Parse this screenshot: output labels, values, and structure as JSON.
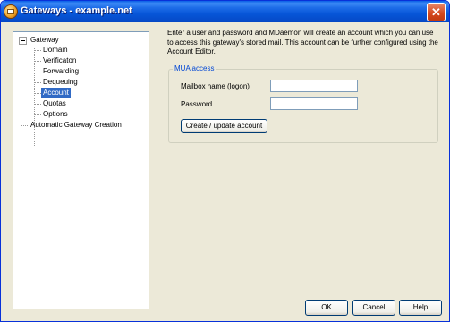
{
  "window": {
    "title": "Gateways - example.net",
    "close_glyph": "✕"
  },
  "tree": {
    "root": "Gateway",
    "children": [
      "Domain",
      "Verificaton",
      "Forwarding",
      "Dequeuing",
      "Account",
      "Quotas",
      "Options"
    ],
    "selected": "Account",
    "sibling": "Automatic Gateway Creation"
  },
  "content": {
    "intro": "Enter a user and password and MDaemon will create an account which you can use to access this gateway's stored mail.  This account can be further configured using the Account Editor.",
    "group_title": "MUA access",
    "mailbox_label": "Mailbox name (logon)",
    "mailbox_value": "",
    "password_label": "Password",
    "password_value": "",
    "create_button": "Create / update account"
  },
  "buttons": {
    "ok": "OK",
    "cancel": "Cancel",
    "help": "Help"
  },
  "colors": {
    "titlebar": "#0a5fe6",
    "selection": "#316ac5",
    "group_title": "#0046d5"
  },
  "icons": {
    "app": "mdaemon-app-icon",
    "close": "close-icon",
    "tree_expander": "collapse-minus-icon"
  }
}
